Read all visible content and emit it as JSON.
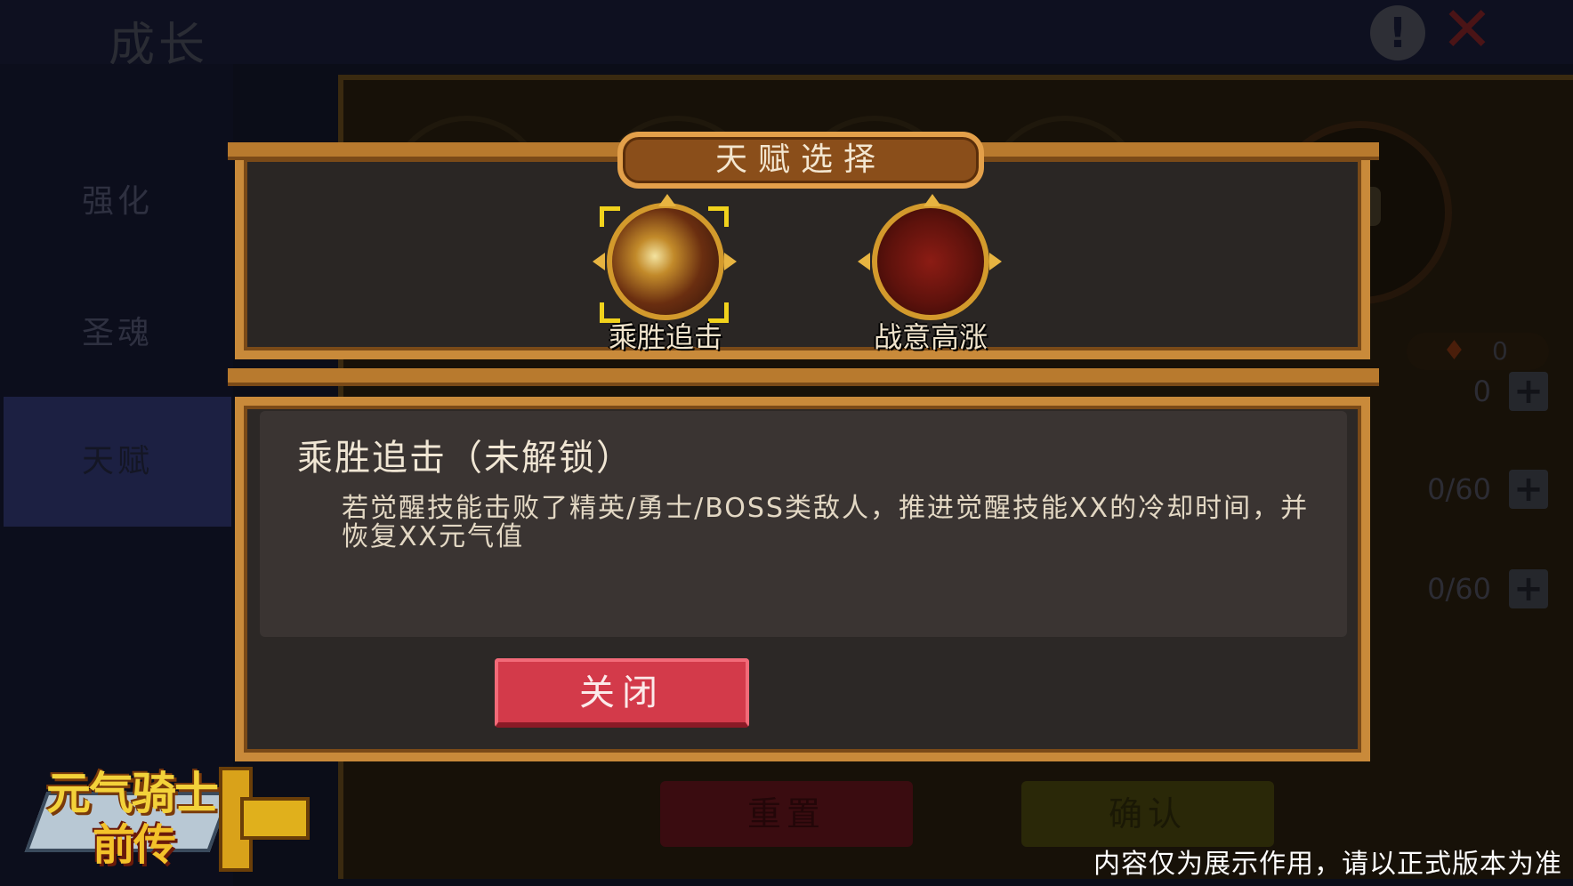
{
  "background": {
    "page_title": "成长",
    "help_glyph": "!",
    "close_glyph": "✕",
    "sidebar": [
      {
        "label": "强化",
        "active": false
      },
      {
        "label": "圣魂",
        "active": false
      },
      {
        "label": "天赋",
        "active": true
      }
    ],
    "flame_count": "0",
    "stats": [
      {
        "value": "0"
      },
      {
        "value": "0/60"
      },
      {
        "value": "0/60"
      }
    ],
    "reset_label": "重置",
    "confirm_label": "确认"
  },
  "modal": {
    "title": "天赋选择",
    "talents": [
      {
        "label": "乘胜追击",
        "selected": true,
        "icon": "sword-slash-icon"
      },
      {
        "label": "战意高涨",
        "selected": false,
        "icon": "warrior-rage-icon"
      }
    ],
    "description": {
      "title": "乘胜追击（未解锁）",
      "body": "若觉醒技能击败了精英/勇士/BOSS类敌人，推进觉醒技能XX的冷却时间，并恢复XX元气值"
    },
    "close_label": "关闭"
  },
  "logo": {
    "line1": "元气骑士",
    "line2": "前传"
  },
  "disclaimer": "内容仅为展示作用，请以正式版本为准",
  "colors": {
    "frame": "#c98a3a",
    "close_button": "#d33a4a",
    "select_highlight": "#f1d21c"
  }
}
